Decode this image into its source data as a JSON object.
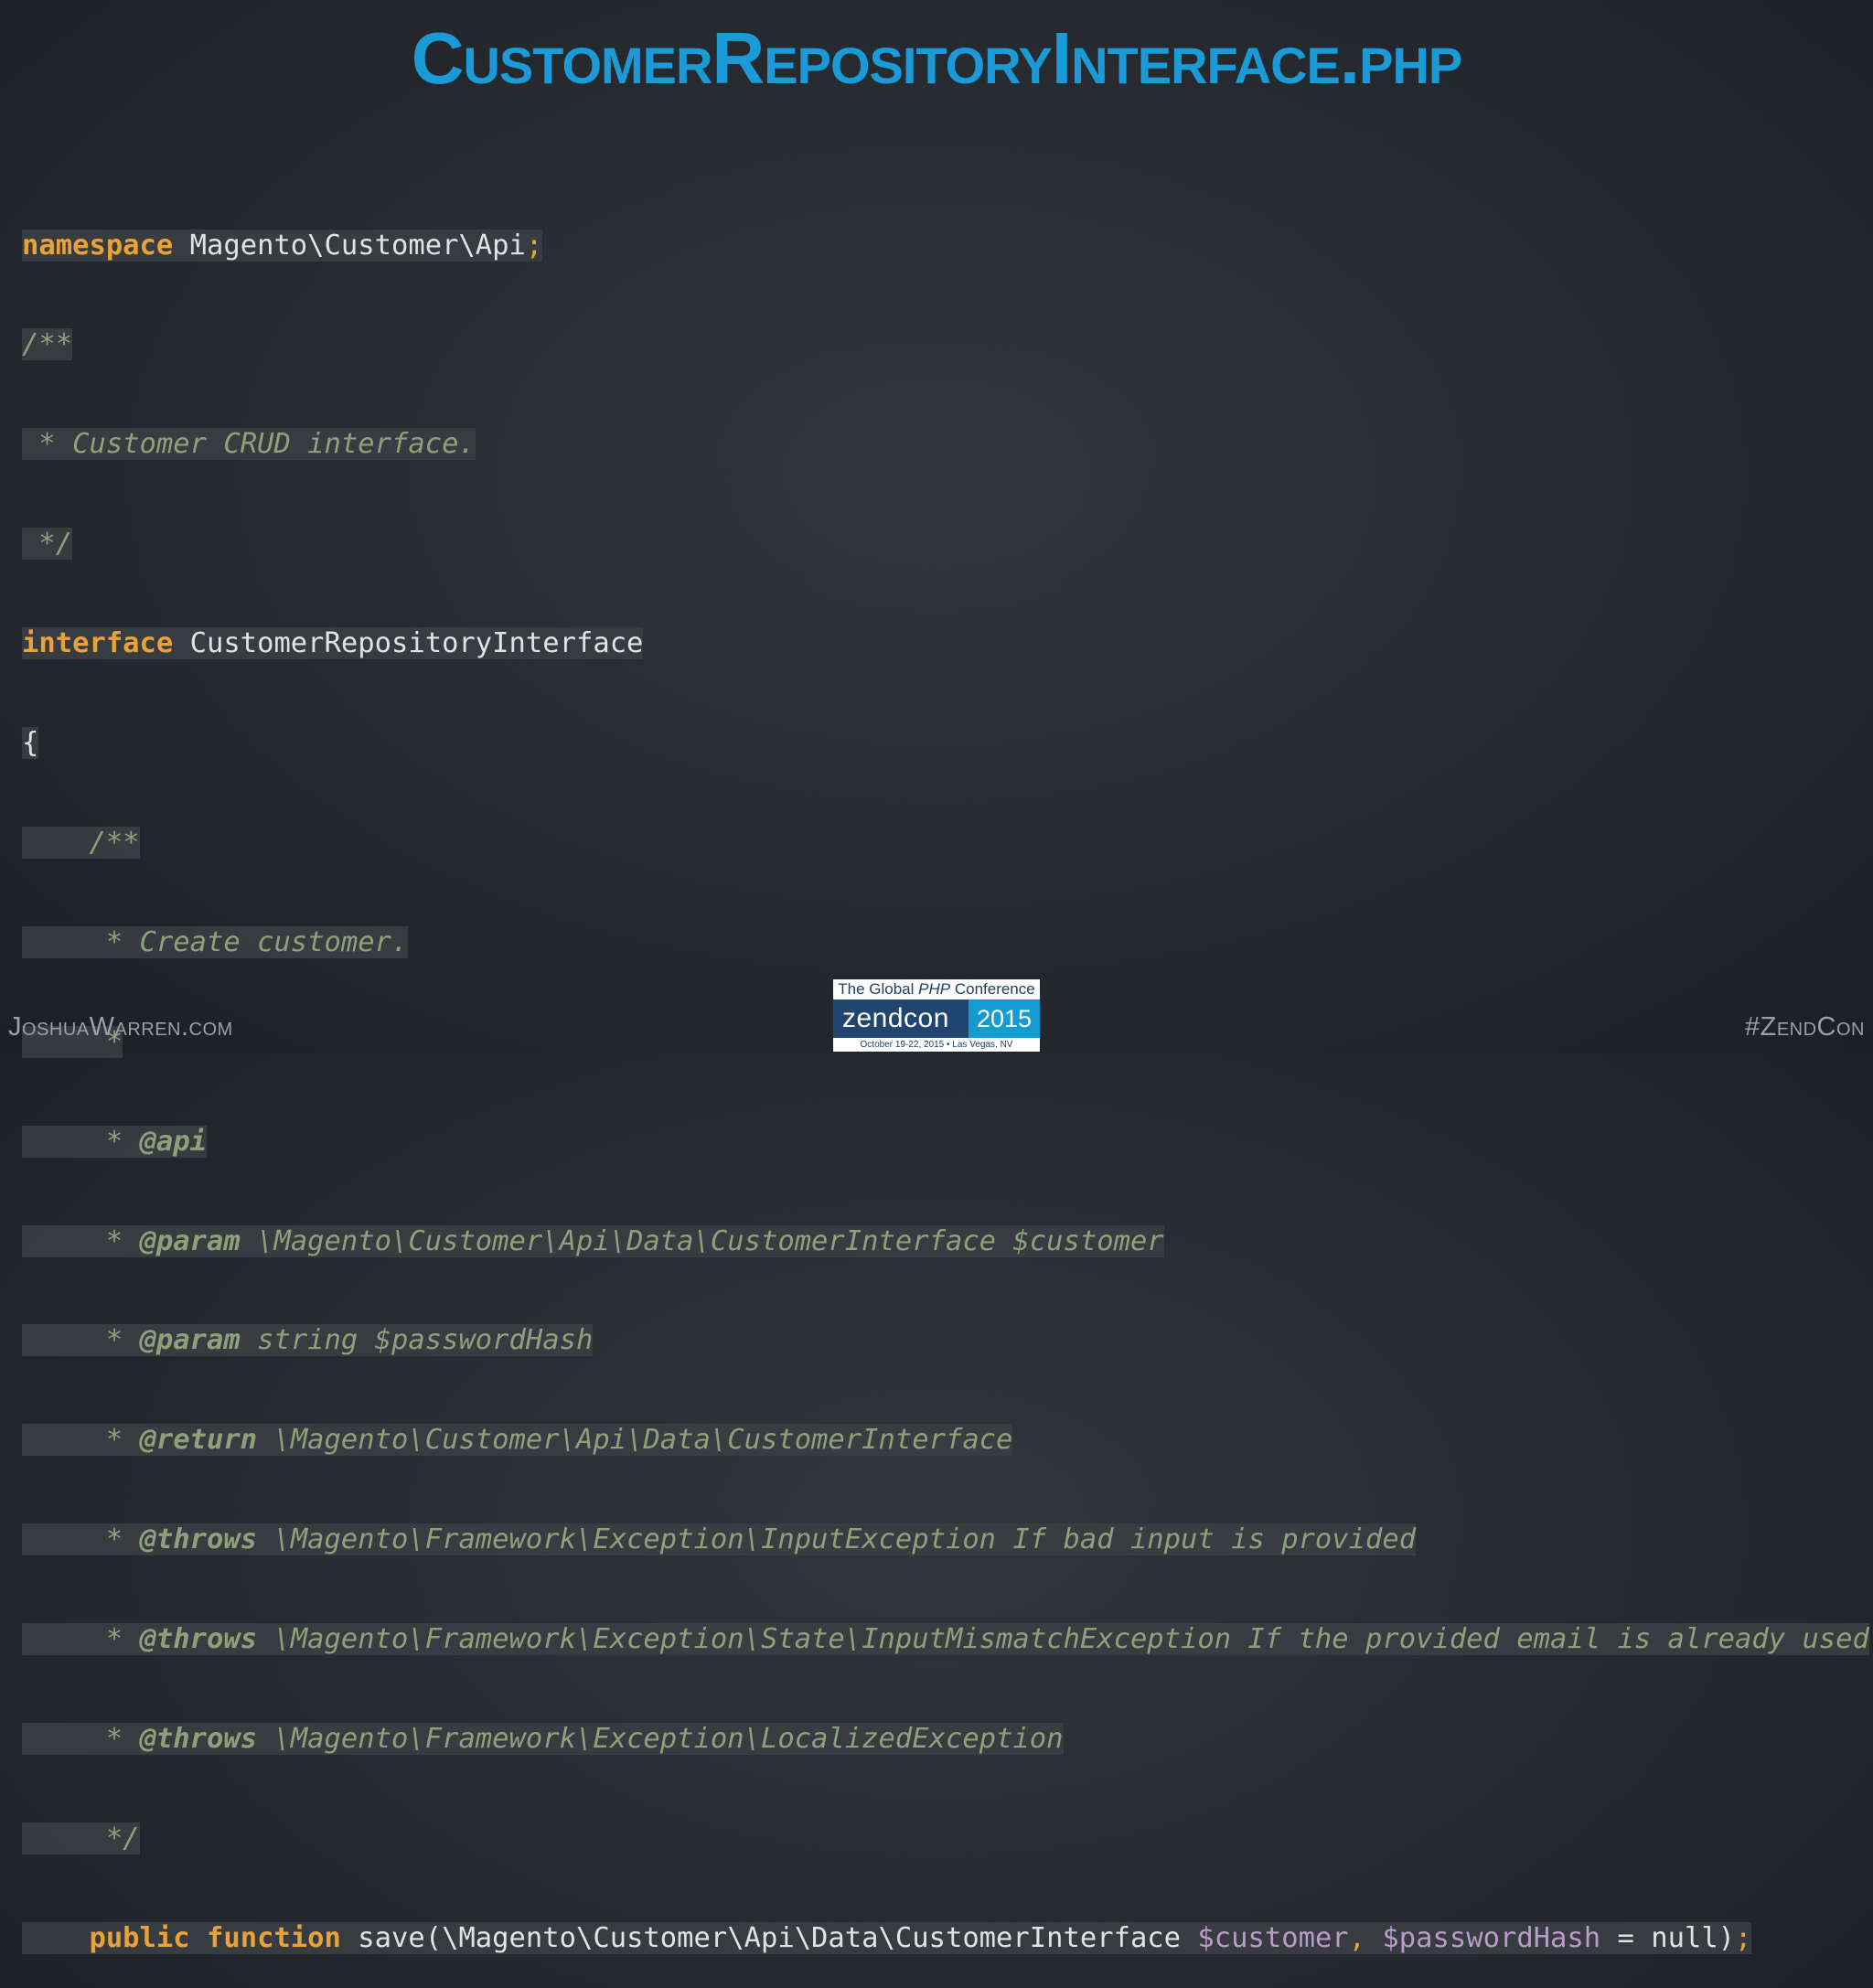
{
  "slide": {
    "title": "CustomerRepositoryInterface.php"
  },
  "code": {
    "l1_kw": "namespace",
    "l1_rest": " Magento\\Customer\\Api",
    "l1_semi": ";",
    "l2": "/**",
    "l3": " * Customer CRUD interface.",
    "l4": " */",
    "l5_kw": "interface",
    "l5_rest": " CustomerRepositoryInterface",
    "l6": "{",
    "l7": "    /**",
    "l8": "     * Create customer.",
    "l9": "     *",
    "l10_star": "     * ",
    "l10_tag": "@api",
    "l11_star": "     * ",
    "l11_tag": "@param",
    "l11_rest": " \\Magento\\Customer\\Api\\Data\\CustomerInterface $customer",
    "l12_star": "     * ",
    "l12_tag": "@param",
    "l12_rest": " string $passwordHash",
    "l13_star": "     * ",
    "l13_tag": "@return",
    "l13_rest": " \\Magento\\Customer\\Api\\Data\\CustomerInterface",
    "l14_star": "     * ",
    "l14_tag": "@throws",
    "l14_rest": " \\Magento\\Framework\\Exception\\InputException If bad input is provided",
    "l15_star": "     * ",
    "l15_tag": "@throws",
    "l15_rest": " \\Magento\\Framework\\Exception\\State\\InputMismatchException If the provided email is already used",
    "l16_star": "     * ",
    "l16_tag": "@throws",
    "l16_rest": " \\Magento\\Framework\\Exception\\LocalizedException",
    "l17": "     */",
    "l18_indent": "    ",
    "l18_kw": "public function",
    "l18_sig": " save(\\Magento\\Customer\\Api\\Data\\CustomerInterface ",
    "l18_var1": "$customer",
    "l18_comma": ",",
    "l18_space": " ",
    "l18_var2": "$passwordHash",
    "l18_tail": " = null)",
    "l18_semi": ";"
  },
  "footer": {
    "left": "JoshuaWarren.com",
    "right": "#ZendCon"
  },
  "conference": {
    "tagline_pre": "The Global ",
    "tagline_php": "PHP",
    "tagline_post": " Conference",
    "name": "zendcon",
    "year": "2015",
    "dates": "October 19-22, 2015 • Las Vegas, NV"
  },
  "colors": {
    "title": "#1a9ad6",
    "keyword": "#e8a23a",
    "comment": "#8ea07a",
    "variable": "#b99ac9",
    "background": "#262a2f"
  }
}
